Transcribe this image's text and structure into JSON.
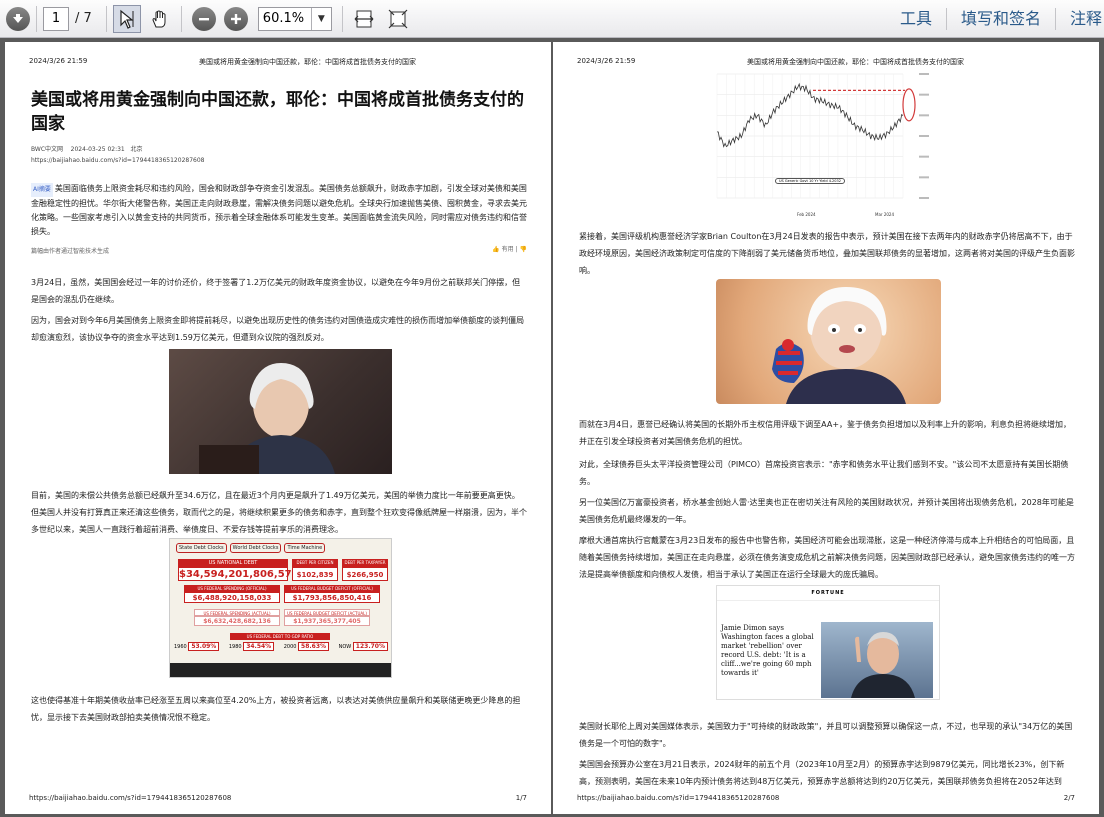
{
  "toolbar": {
    "current_page": "1",
    "total_pages": "/ 7",
    "zoom": "60.1%",
    "menu": [
      "工具",
      "填写和签名",
      "注释"
    ]
  },
  "doc": {
    "datetime": "2024/3/26 21:59",
    "header_title": "美国或将用黄金强制向中国还款，耶伦：中国将成首批债务支付的国家",
    "url": "https://baijiahao.baidu.com/s?id=1794418365120287608",
    "page1_num": "1/7",
    "page2_num": "2/7"
  },
  "page1": {
    "title": "美国或将用黄金强制向中国还款，耶伦：中国将成首批债务支付的国家",
    "source": "BWC中文网",
    "date": "2024-03-25 02:31",
    "location": "北京",
    "url": "https://baijiahao.baidu.com/s?id=1794418365120287608",
    "ai_tag": "AI摘要",
    "ai_summary": "美国面临债务上限资金耗尽和违约风险，国会和财政部争夺资金引发混乱。美国债务总额飙升，财政赤字加剧，引发全球对美债和美国金融稳定性的担忧。华尔街大佬警告称，美国正走向财政悬崖，需解决债务问题以避免危机。全球央行加速抛售美债、囤积黄金，寻求去美元化策略。一些国家考虑引入以黄金支持的共同货币，预示着全球金融体系可能发生变革。美国面临黄金流失风险，同时需应对债务违约和信誉损失。",
    "ai_note": "篇幅由作者通过智能技术生成",
    "ai_useful": "有用",
    "p1": "3月24日，虽然，美国国会经过一年的讨价还价，终于签署了1.2万亿美元的财政年度资金协议，以避免在今年9月份之前联邦关门停摆，但是国会的混乱仍在继续。",
    "p2": "因为，国会对到今年6月美国债务上限资金即将提前耗尽，以避免出现历史性的债务违约对国债造成灾难性的损伤而增加举债额度的谈判僵局却愈演愈烈，该协议争夺的资金水平达到1.59万亿美元，但遭到众议院的强烈反对。",
    "p3": "目前，美国的未偿公共债务总额已经飙升至34.6万亿，且在最近3个月内更是飙升了1.49万亿美元，美国的举债力度比一年前要更高更快。但美国人并没有打算真正来还清这些债务，取而代之的是，将继续积累更多的债务和赤字，直到整个狂欢变得像纸牌屋一样崩溃，因为，半个多世纪以来，美国人一直践行着超前消费、举债度日、不爱存钱等提前享乐的消费理念。",
    "p4": "这也使得基准十年期美债收益率已经涨至五周以来高位至4.20%上方，被投资者远离，以表达对美债供应量飙升和美联储更晚更少降息的担忧，显示接下去美国财政部拍卖美债情况恨不稳定。"
  },
  "debt_clock": {
    "tabs": [
      "State Debt Clocks",
      "World Debt Clocks",
      "Time Machine"
    ],
    "national_label": "US NATIONAL DEBT",
    "national_value": "$34,594,201,806,575",
    "per_citizen_label": "DEBT PER CITIZEN",
    "per_citizen_value": "$102,839",
    "per_taxpayer_label": "DEBT PER TAXPAYER",
    "per_taxpayer_value": "$266,950",
    "spending_label": "US FEDERAL SPENDING (OFFICIAL)",
    "spending_value": "$6,488,920,158,033",
    "deficit_label": "US FEDERAL BUDGET DEFICIT (OFFICIAL)",
    "deficit_value": "$1,793,856,850,416",
    "spending_actual_label": "US FEDERAL SPENDING (ACTUAL)",
    "spending_actual_value": "$6,632,428,682,136",
    "deficit_actual_label": "US FEDERAL BUDGET DEFICIT (ACTUAL)",
    "deficit_actual_value": "$1,937,365,377,405",
    "ratio_label": "US FEDERAL DEBT TO GDP RATIO",
    "ratios": [
      {
        "year": "1960",
        "value": "53.09%"
      },
      {
        "year": "1980",
        "value": "34.54%"
      },
      {
        "year": "2000",
        "value": "58.63%"
      },
      {
        "year": "NOW",
        "value": "123.70%"
      }
    ]
  },
  "page2": {
    "chart_legend": "US Generic Govt 10 Yr Yield 4.2032",
    "chart_month1": "Feb 2024",
    "chart_month2": "Mar 2024",
    "p1": "紧接着，美国评级机构惠誉经济学家Brian Coulton在3月24日发表的报告中表示，预计美国在接下去两年内的财政赤字仍将居高不下，由于政经环境原因，美国经济政策制定可信度的下降削弱了美元储备货币地位，叠加美国联邦债务的显著增加，这两者将对美国的评级产生负面影响。",
    "p2": "而就在3月4日，惠誉已经确认将美国的长期外币主权信用评级下调至AA+，鉴于债务负担增加以及利率上升的影响，利息负担将继续增加，并正在引发全球投资者对美国债务危机的担忧。",
    "p3": "对此，全球债券巨头太平洋投资管理公司（PIMCO）首席投资官表示：\"赤字和债务水平让我们感到不安。\"该公司不太愿意持有美国长期债务。",
    "p4": "另一位美国亿万富豪投资者，桥水基金创始人雷·达里奥也正在密切关注有风险的美国财政状况，并预计美国将出现债务危机，2028年可能是美国债务危机最终爆发的一年。",
    "p5": "摩根大通首席执行官戴蒙在3月23日发布的报告中也警告称，美国经济可能会出现滞胀，这是一种经济停滞与成本上升相结合的可怕局面，且随着美国债务持续增加，美国正在走向悬崖，必须在债务演变成危机之前解决债务问题，因美国财政部已经承认，避免国家债务违约的唯一方法是提高举债额度和向债权人发债，相当于承认了美国正在运行全球最大的庞氏骗局。",
    "p6": "美国财长耶伦上周对美国媒体表示，美国致力于\"可持续的财政政策\"，并且可以调整预算以确保这一点，不过，也早现的承认\"34万亿的美国债务是一个可怕的数字\"。",
    "p7": "美国国会预算办公室在3月21日表示，2024财年的前五个月（2023年10月至2月）的预算赤字达到9879亿美元，同比增长23%，创下新高，预测表明，美国在未来10年内预计债务将达到48万亿美元，预算赤字总额将达到约20万亿美元，美国联邦债务负担将在2052年达到"
  },
  "fortune": {
    "brand": "FORTUNE",
    "headline": "Jamie Dimon says Washington faces a global market 'rebellion' over record U.S. debt: 'It is a cliff...we're going 60 mph towards it'"
  },
  "chart_data": {
    "type": "line",
    "series": [
      {
        "name": "US Generic Govt 10 Yr Yield 4.2032",
        "values": [
          4.12,
          4.05,
          4.08,
          4.1,
          4.18,
          4.2,
          4.15,
          4.22,
          4.26,
          4.3,
          4.34,
          4.33,
          4.28,
          4.27,
          4.25,
          4.24,
          4.2,
          4.15,
          4.13,
          4.1,
          4.09,
          4.11,
          4.15,
          4.2
        ]
      }
    ],
    "x_labels": [
      "Feb 2024",
      "Mar 2024"
    ],
    "ylim": [
      3.8,
      4.4
    ],
    "grid": true
  },
  "colors": {
    "toolbar_menu": "#2a5a8a",
    "debt_red": "#c8201f",
    "chart_line": "#333333",
    "chart_highlight": "#d23a3a"
  }
}
